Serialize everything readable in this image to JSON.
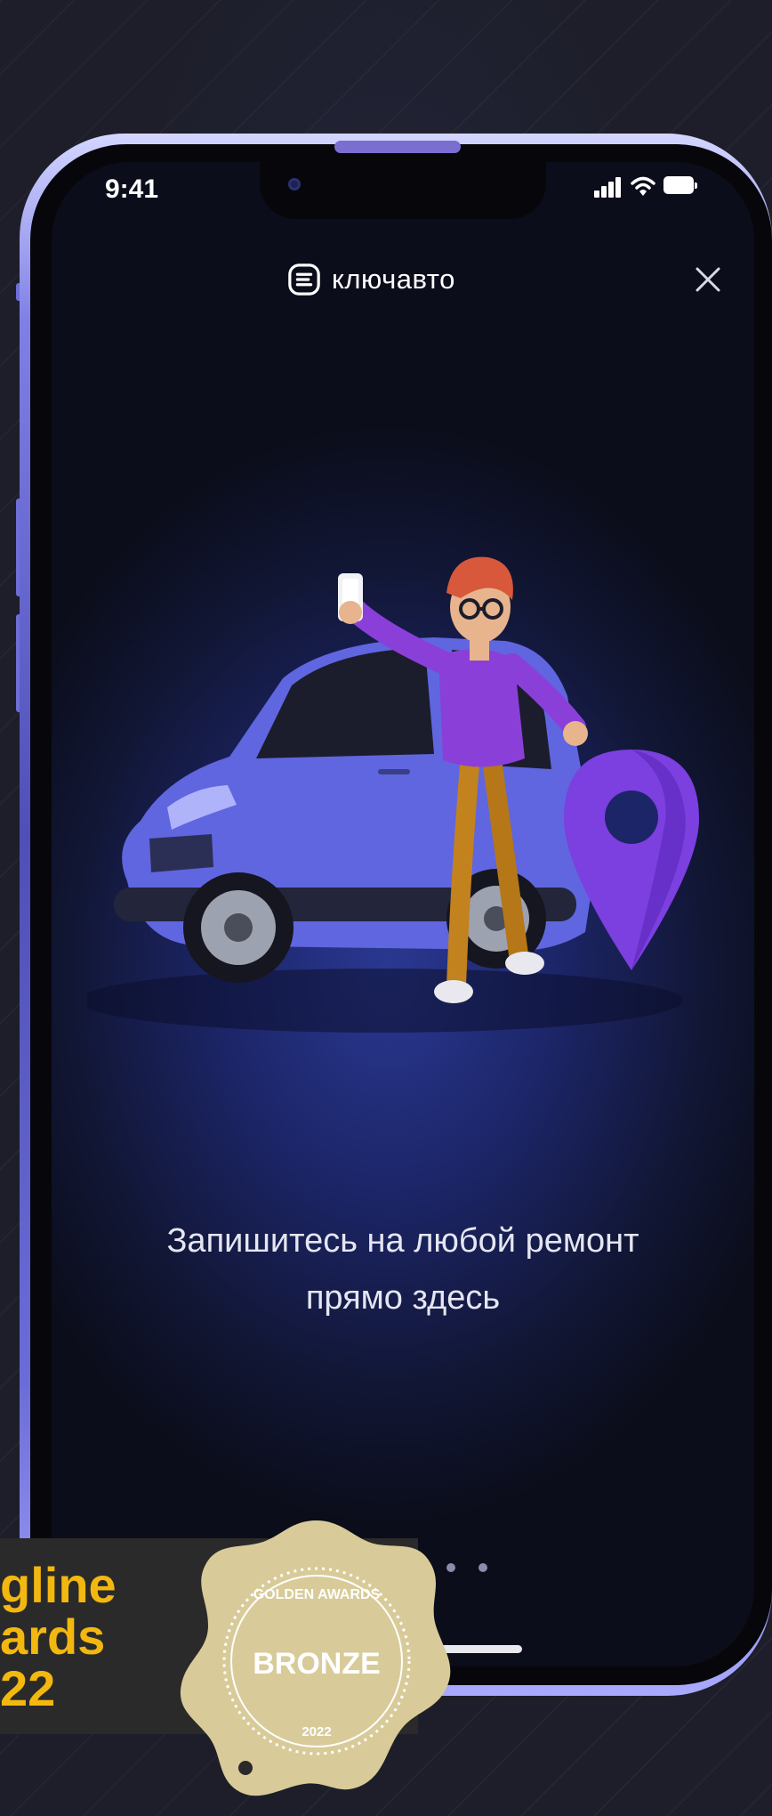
{
  "status_bar": {
    "time": "9:41"
  },
  "header": {
    "brand": "ключавто",
    "logo_icon": "brand-logo-icon",
    "close_icon": "close-icon"
  },
  "onboarding": {
    "caption_line1": "Запишитесь на любой ремонт",
    "caption_line2": "прямо здесь",
    "page_count": 3
  },
  "award": {
    "text_line1": "gline",
    "text_line2": "ards",
    "text_line3": "22",
    "badge_top_text": "GOLDEN AWARDS",
    "badge_label": "BRONZE",
    "badge_year": "2022"
  },
  "colors": {
    "accent": "#f3b80f",
    "badge": "#d8cb99",
    "phone_frame": "#6a6cd8",
    "brand_purple": "#8b3fd9"
  }
}
